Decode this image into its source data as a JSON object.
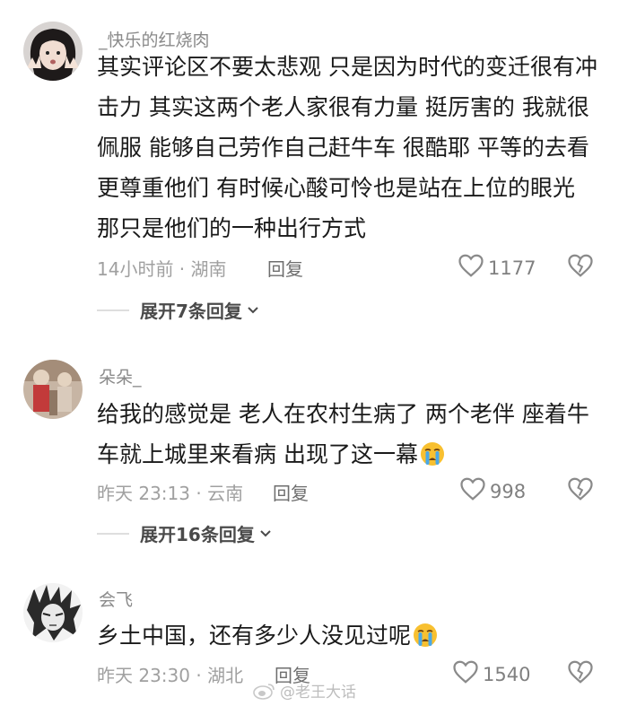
{
  "comments": [
    {
      "username": "_快乐的红烧肉",
      "text": "其实评论区不要太悲观 只是因为时代的变迁很有冲击力 其实这两个老人家很有力量 挺厉害的 我就很佩服 能够自己劳作自己赶牛车 很酷耶 平等的去看更尊重他们 有时候心酸可怜也是站在上位的眼光 那只是他们的一种出行方式",
      "meta": "14小时前 · 湖南",
      "reply": "回复",
      "likes": "1177",
      "expand": "展开7条回复"
    },
    {
      "username": "朵朵_",
      "text": "给我的感觉是 老人在农村生病了 两个老伴 座着牛车就上城里来看病 出现了这一幕",
      "meta": "昨天 23:13 · 云南",
      "reply": "回复",
      "likes": "998",
      "expand": "展开16条回复"
    },
    {
      "username": "会飞",
      "text": "乡土中国，还有多少人没见过呢",
      "meta": "昨天 23:30 · 湖北",
      "reply": "回复",
      "likes": "1540"
    }
  ],
  "watermark": "@老王大话",
  "icons": {
    "like": "heart-outline-icon",
    "dislike": "broken-heart-icon",
    "expand": "chevron-down-icon",
    "emoji": "crying-face-emoji-icon",
    "watermark": "weibo-logo-icon"
  }
}
